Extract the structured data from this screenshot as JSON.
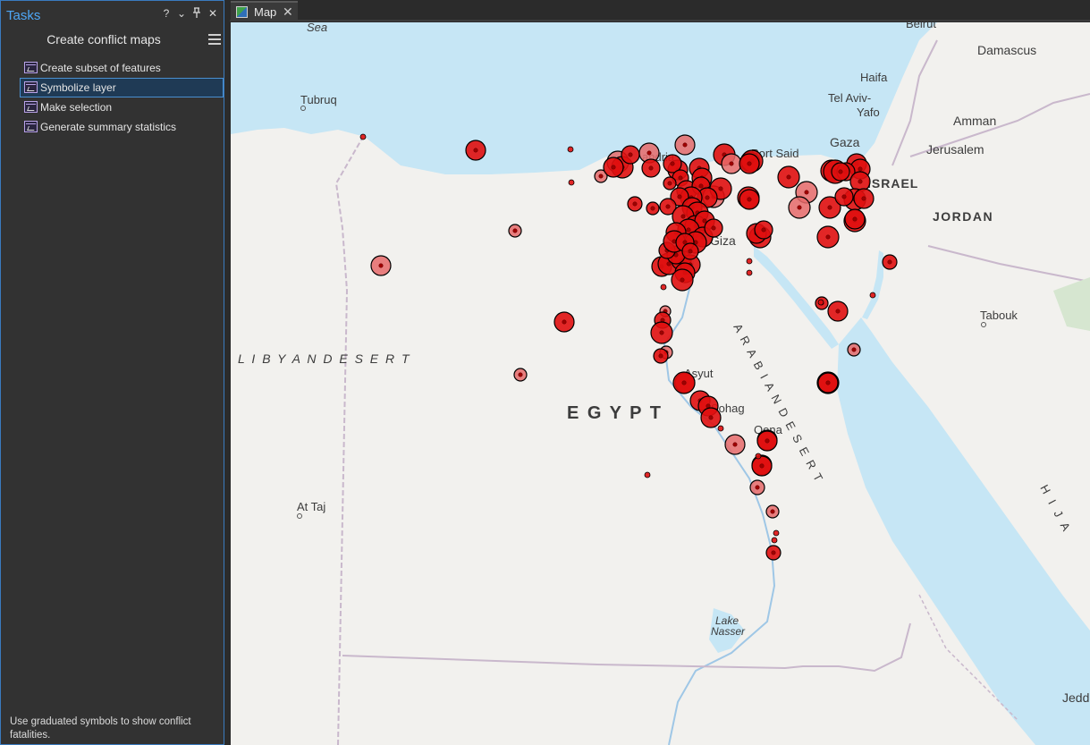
{
  "tasks_pane": {
    "title": "Tasks",
    "controls": {
      "help": "?",
      "menu": "⌄",
      "pin": "📌",
      "close": "✕"
    },
    "task_name": "Create conflict maps",
    "items": [
      {
        "label": "Create subset of features",
        "selected": false
      },
      {
        "label": "Symbolize layer",
        "selected": true
      },
      {
        "label": "Make selection",
        "selected": false
      },
      {
        "label": "Generate summary statistics",
        "selected": false
      }
    ],
    "description": "Use graduated symbols to show conflict fatalities."
  },
  "map_tab": {
    "label": "Map",
    "close": "✕"
  },
  "map": {
    "labels": {
      "sea": "Sea",
      "beirut": "Beirut",
      "damascus": "Damascus",
      "haifa": "Haifa",
      "tel_aviv": "Tel Aviv-",
      "yafo": "Yafo",
      "amman": "Amman",
      "jerusalem": "Jerusalem",
      "gaza": "Gaza",
      "israel": "ISRAEL",
      "jordan": "JORDAN",
      "port_said": "Port Said",
      "tobruk": "Tubruq",
      "giza": "Giza",
      "libyan_desert": "L I B Y A N   D E S E R T",
      "egypt": "E G Y P T",
      "arabian_desert": "A R A B I A N   D E S E R T",
      "asyut": "Asyut",
      "sohag": "Sohag",
      "qena": "Qena",
      "tabouk": "Tabouk",
      "at_taj": "At Taj",
      "lake": "Lake",
      "nasser": "Nasser",
      "hijaz": "H I J A",
      "jeddah": "Jedd",
      "andria_fragment": "andria"
    },
    "colors": {
      "land": "#f2f1ee",
      "water": "#c6e6f5",
      "water_deep": "#b3dcf0",
      "point": "#e01010",
      "point_light": "#e66a6a",
      "outline": "#000000"
    }
  }
}
